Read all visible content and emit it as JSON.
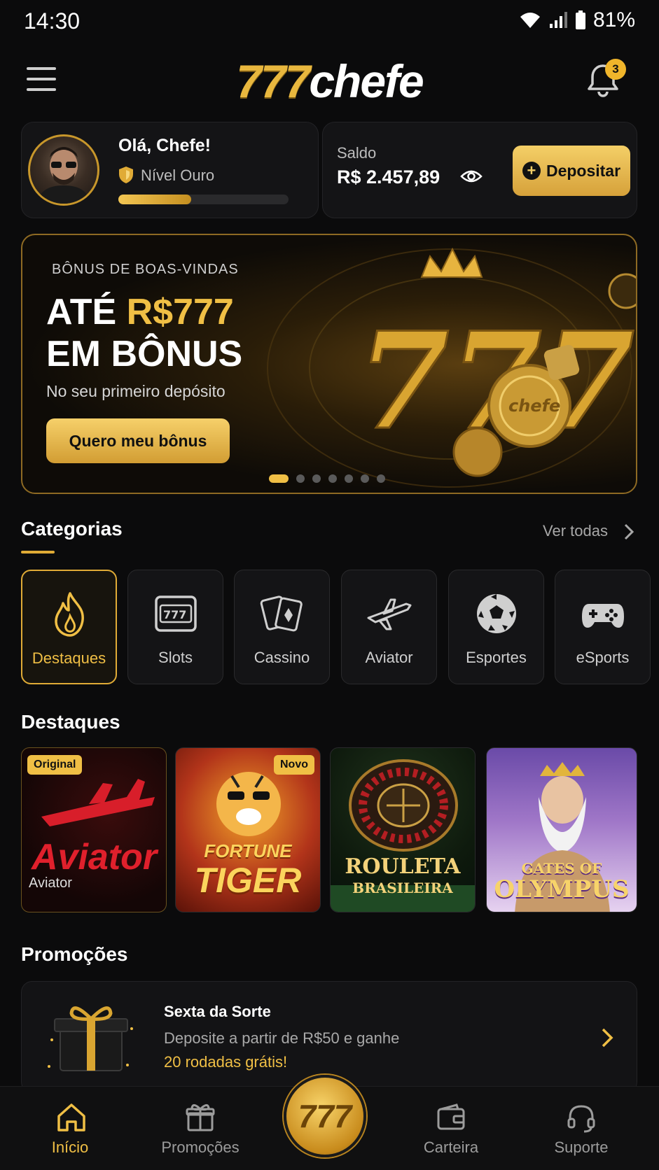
{
  "status_bar": {
    "time": "14:30",
    "battery": "81%"
  },
  "header": {
    "logo_number": "777",
    "logo_word": "chefe",
    "notifications_count": "3"
  },
  "profile": {
    "greeting": "Olá, Chefe!",
    "level": "Nível Ouro",
    "level_progress": 0.43
  },
  "balance": {
    "label": "Saldo",
    "value": "R$ 2.457,89",
    "deposit_label": "Depositar"
  },
  "banner": {
    "kicker": "BÔNUS DE BOAS-VINDAS",
    "title_prefix": "ATÉ ",
    "title_highlight": "R$777",
    "title_line2": "EM BÔNUS",
    "subtitle": "No seu primeiro depósito",
    "cta": "Quero meu bônus",
    "slides": 7,
    "active_slide": 1
  },
  "categories": {
    "title": "Categorias",
    "see_all": "Ver todas",
    "items": [
      {
        "label": "Destaques",
        "icon": "flame-icon",
        "active": true
      },
      {
        "label": "Slots",
        "icon": "slot-machine-icon",
        "active": false
      },
      {
        "label": "Cassino",
        "icon": "cards-icon",
        "active": false
      },
      {
        "label": "Aviator",
        "icon": "airplane-icon",
        "active": false
      },
      {
        "label": "Esportes",
        "icon": "soccer-ball-icon",
        "active": false
      },
      {
        "label": "eSports",
        "icon": "gamepad-icon",
        "active": false
      }
    ]
  },
  "highlights": {
    "title": "Destaques",
    "games": [
      {
        "art_title": "Aviator",
        "caption": "Aviator",
        "tag": "Original"
      },
      {
        "art_title_1": "FORTUNE",
        "art_title_2": "TIGER",
        "tag": "Novo"
      },
      {
        "art_title_1": "ROULETA",
        "art_title_2": "BRASILEIRA"
      },
      {
        "art_title_1": "GATES OF",
        "art_title_2": "OLYMPUS"
      }
    ]
  },
  "promotions": {
    "title": "Promoções",
    "items": [
      {
        "title": "Sexta da Sorte",
        "text": "Deposite a partir de R$50 e ganhe",
        "highlight": "20 rodadas grátis!"
      }
    ]
  },
  "bottom_nav": {
    "items": [
      {
        "label": "Início",
        "icon": "home-icon",
        "active": true
      },
      {
        "label": "Promoções",
        "icon": "gift-icon",
        "active": false
      },
      {
        "label": "777",
        "icon": "777-coin-icon",
        "active": false
      },
      {
        "label": "Carteira",
        "icon": "wallet-icon",
        "active": false
      },
      {
        "label": "Suporte",
        "icon": "headset-icon",
        "active": false
      }
    ]
  },
  "colors": {
    "gold": "#f0bf45",
    "background": "#0b0b0c",
    "card": "#141416"
  }
}
